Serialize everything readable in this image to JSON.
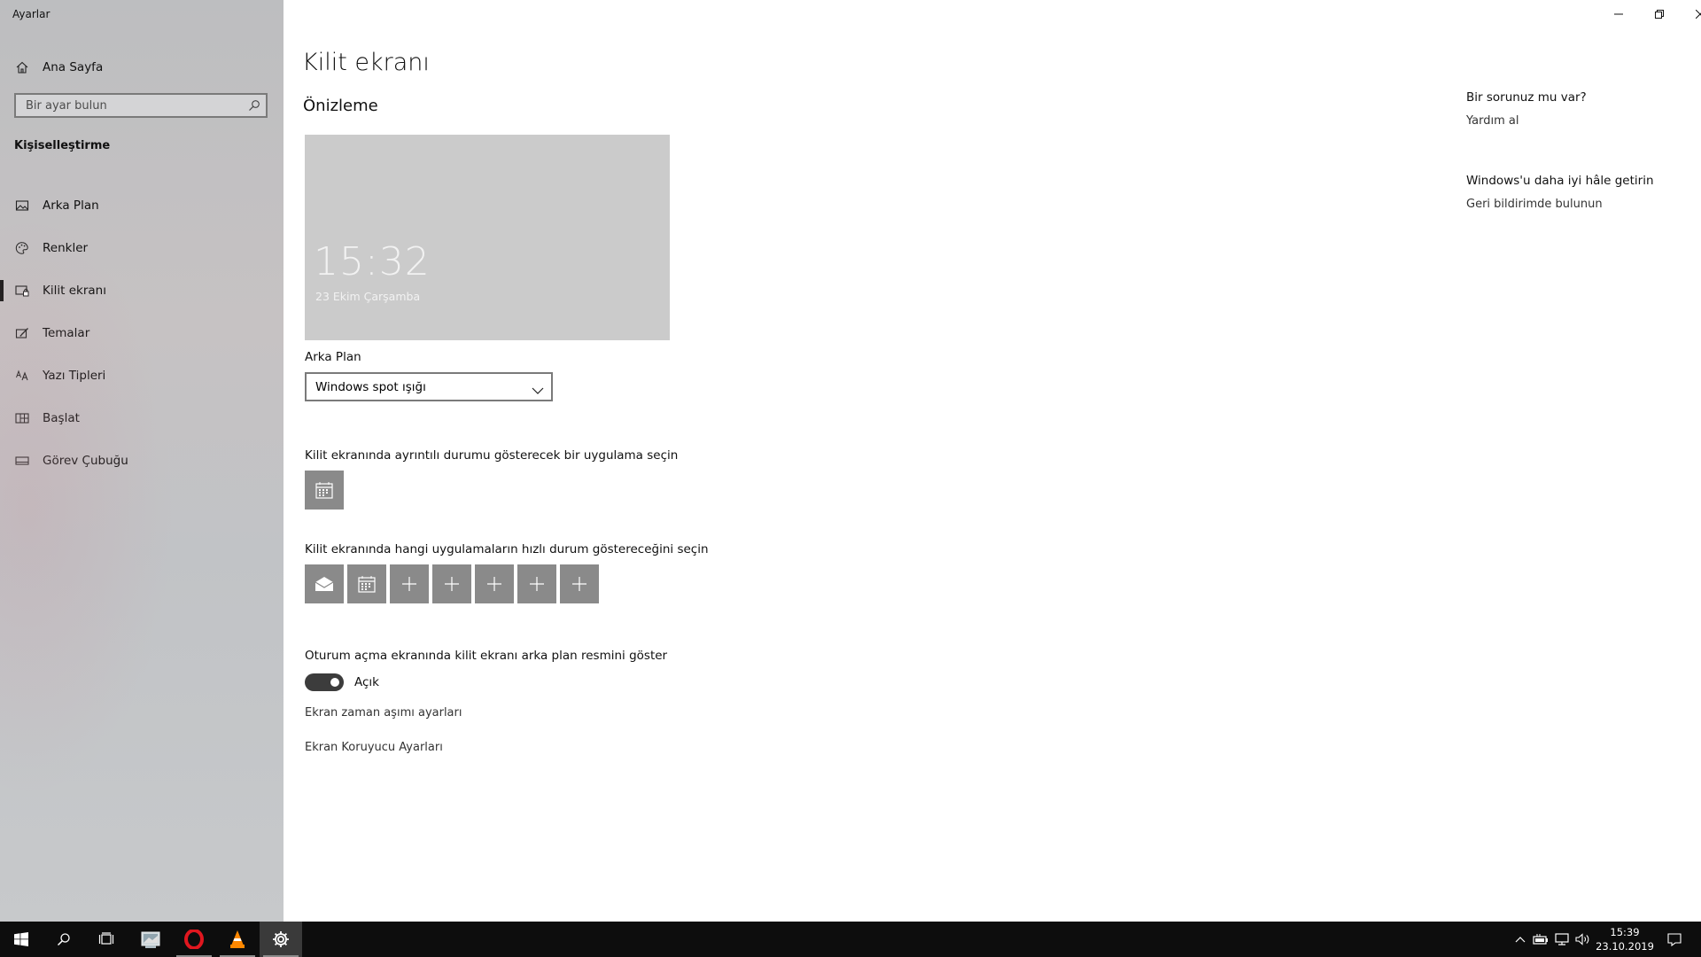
{
  "window": {
    "app_title": "Ayarlar"
  },
  "sidebar": {
    "home_label": "Ana Sayfa",
    "search_placeholder": "Bir ayar bulun",
    "section_title": "Kişiselleştirme",
    "items": [
      {
        "label": "Arka Plan",
        "icon": "picture-icon"
      },
      {
        "label": "Renkler",
        "icon": "palette-icon"
      },
      {
        "label": "Kilit ekranı",
        "icon": "lock-screen-icon",
        "active": true
      },
      {
        "label": "Temalar",
        "icon": "theme-brush-icon"
      },
      {
        "label": "Yazı Tipleri",
        "icon": "fonts-icon"
      },
      {
        "label": "Başlat",
        "icon": "start-icon"
      },
      {
        "label": "Görev Çubuğu",
        "icon": "taskbar-icon"
      }
    ]
  },
  "main": {
    "title": "Kilit ekranı",
    "preview_heading": "Önizleme",
    "preview": {
      "time": "15:32",
      "date": "23 Ekim Çarşamba"
    },
    "background_label": "Arka Plan",
    "background_value": "Windows spot ışığı",
    "detailed_status_label": "Kilit ekranında ayrıntılı durumu gösterecek bir uygulama seçin",
    "quick_status_label": "Kilit ekranında hangi uygulamaların hızlı durum göstereceğini seçin",
    "quick_status_tiles": [
      "mail-icon",
      "calendar-icon",
      "plus-icon",
      "plus-icon",
      "plus-icon",
      "plus-icon",
      "plus-icon"
    ],
    "signin_bg_label": "Oturum açma ekranında kilit ekranı arka plan resmini göster",
    "toggle_state": "Açık",
    "toggle_on": true,
    "timeout_link": "Ekran zaman aşımı ayarları",
    "screensaver_link": "Ekran Koruyucu Ayarları"
  },
  "aside": {
    "help_heading": "Bir sorunuz mu var?",
    "help_link": "Yardım al",
    "feedback_heading": "Windows'u daha iyi hâle getirin",
    "feedback_link": "Geri bildirimde bulunun"
  },
  "taskbar": {
    "time": "15:39",
    "date": "23.10.2019",
    "apps": [
      "start-icon",
      "search-icon",
      "task-view-icon",
      "file-explorer-icon",
      "opera-icon",
      "vlc-icon",
      "settings-icon"
    ]
  }
}
